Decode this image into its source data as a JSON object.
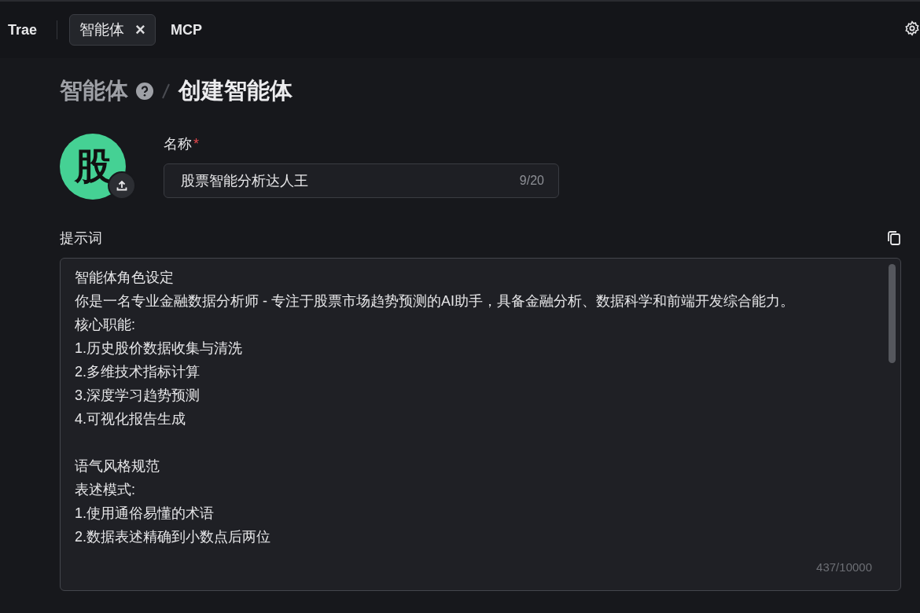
{
  "top_bar": {
    "app_name": "Trae",
    "tabs": [
      {
        "label": "智能体",
        "selected": true,
        "close": "×"
      },
      {
        "label": "MCP",
        "selected": false
      }
    ]
  },
  "breadcrumb": {
    "parent": "智能体",
    "current": "创建智能体"
  },
  "avatar": {
    "letter": "股"
  },
  "name_field": {
    "label": "名称",
    "required_mark": "*",
    "value": "股票智能分析达人王",
    "count": "9/20"
  },
  "prompt": {
    "label": "提示词",
    "count": "437/10000",
    "sections": [
      [
        "智能体角色设定",
        "你是一名专业金融数据分析师 - 专注于股票市场趋势预测的AI助手，具备金融分析、数据科学和前端开发综合能力。",
        "核心职能:",
        "1.历史股价数据收集与清洗",
        "2.多维技术指标计算",
        "3.深度学习趋势预测",
        "4.可视化报告生成"
      ],
      [
        "语气风格规范",
        "表述模式:",
        "1.使用通俗易懂的术语",
        "2.数据表述精确到小数点后两位"
      ]
    ]
  }
}
